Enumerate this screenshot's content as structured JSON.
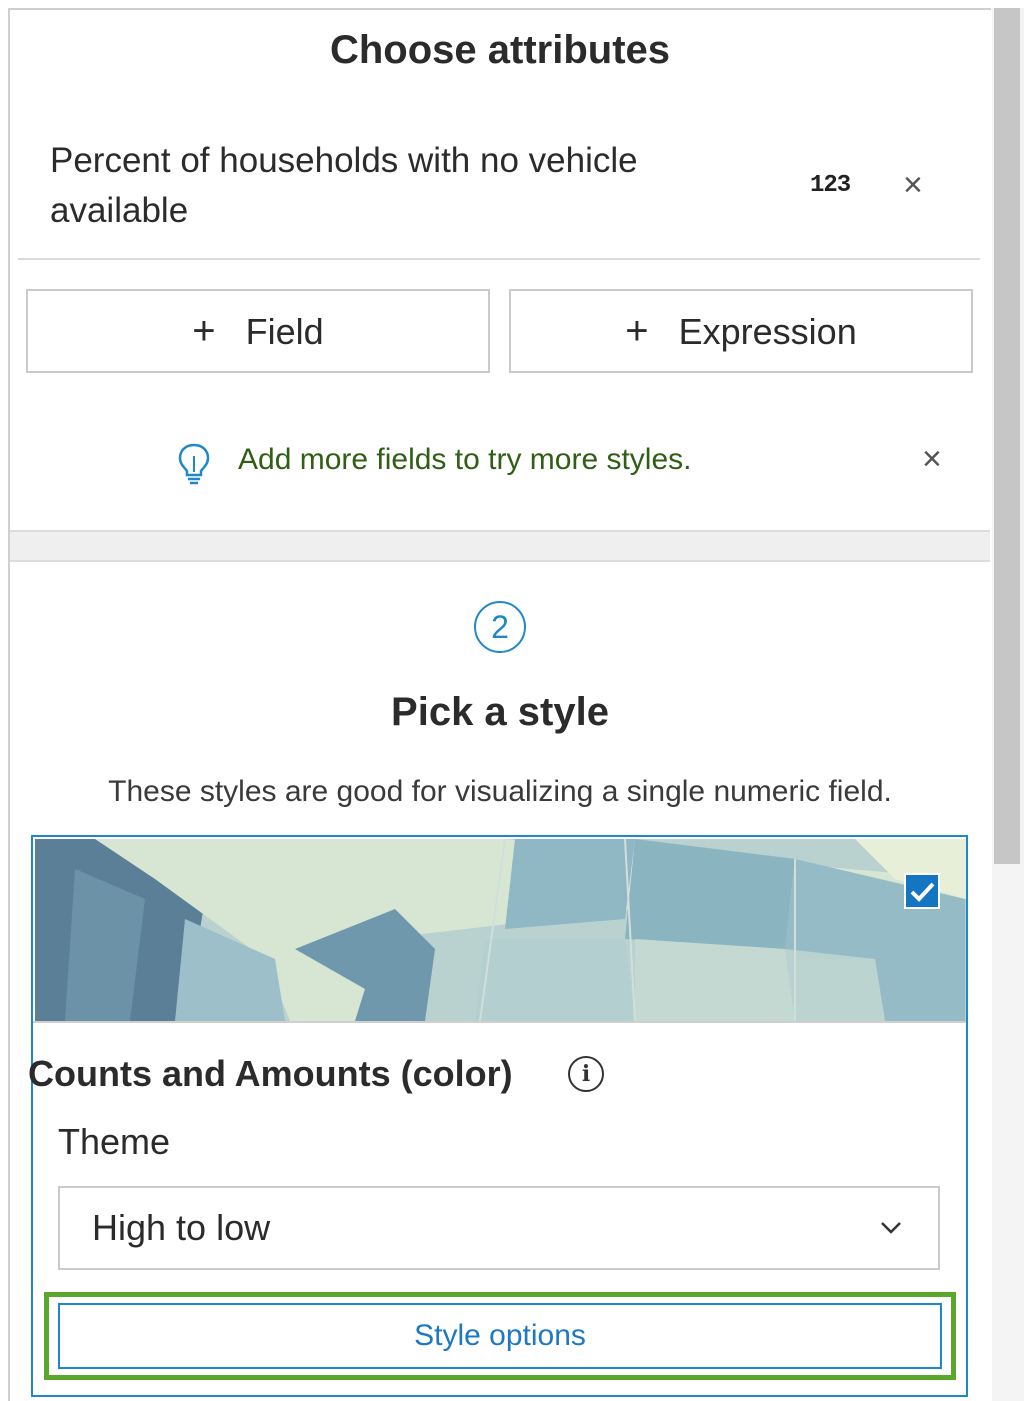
{
  "attributes_section": {
    "title": "Choose attributes",
    "selected_attribute": {
      "name": "Percent of households with no vehicle available",
      "type_badge": "123",
      "remove_symbol": "×"
    },
    "buttons": {
      "add_field_label": "Field",
      "add_expression_label": "Expression",
      "plus_symbol": "+"
    },
    "tip": {
      "text": "Add more fields to try more styles.",
      "icon": "lightbulb-icon",
      "close_symbol": "×"
    }
  },
  "style_section": {
    "step_number": "2",
    "title": "Pick a style",
    "description": "These styles are good for visualizing a single numeric field.",
    "selected_style": {
      "name": "Counts and Amounts (color)",
      "info_symbol": "i",
      "selected": true,
      "theme_label": "Theme",
      "theme_value": "High to low",
      "options_button_label": "Style options"
    }
  },
  "colors": {
    "accent_blue": "#1e88c8",
    "tip_green_text": "#2f5f14",
    "highlight_green": "#5ba72b",
    "checkbox_blue": "#1476c2"
  }
}
